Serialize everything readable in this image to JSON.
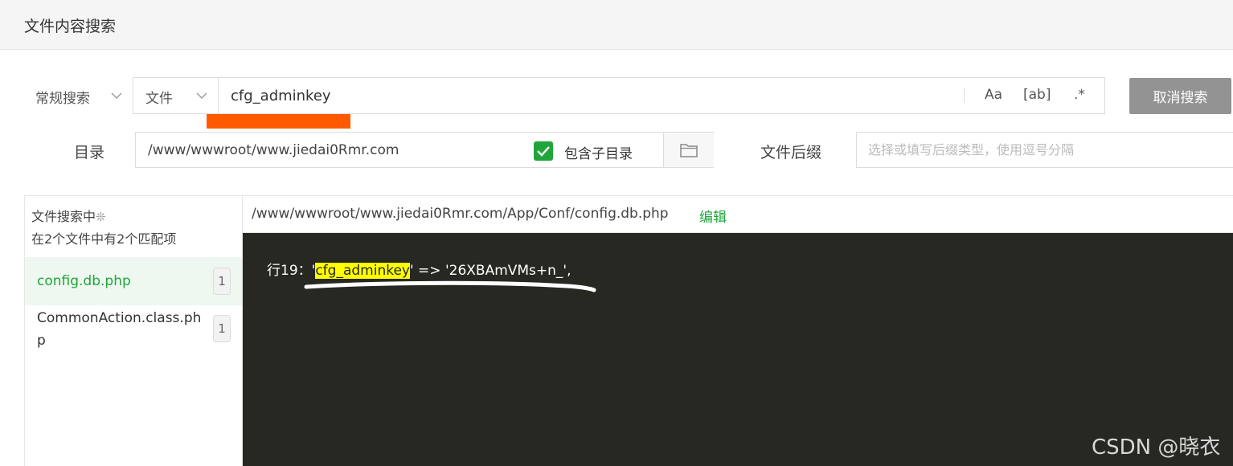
{
  "window": {
    "title": "文件内容搜索"
  },
  "search": {
    "mode_label": "常规搜索",
    "scope_label": "文件",
    "query": "cfg_adminkey",
    "options": {
      "case": "Aa",
      "word": "[ab]",
      "regex": ".*"
    },
    "cancel_label": "取消搜索"
  },
  "directory": {
    "label": "目录",
    "value": "/www/wwwroot/www.jiedai0Rmr.com",
    "include_subdir_label": "包含子目录",
    "include_subdir_checked": true
  },
  "suffix": {
    "label": "文件后缀",
    "placeholder": "选择或填写后缀类型，使用逗号分隔"
  },
  "results": {
    "status": "文件搜索中",
    "summary": "在2个文件中有2个匹配项",
    "files": [
      {
        "name": "config.db.php",
        "count": "1",
        "active": true
      },
      {
        "name": "CommonAction.class.php",
        "count": "1",
        "active": false
      }
    ],
    "current_path": "/www/wwwroot/www.jiedai0Rmr.com/App/Conf/config.db.php",
    "edit_label": "编辑",
    "line": {
      "prefix": "行19：",
      "before": "'",
      "match": "cfg_adminkey",
      "after": "' => '26XBAmVMs+n_',"
    }
  },
  "colors": {
    "accent": "#20a53a",
    "highlight": "#ffff00",
    "annotation": "#ff5a00",
    "code_bg": "#272822"
  },
  "icons": [
    "chevron-down-icon",
    "checkmark-icon",
    "folder-icon",
    "spinner-icon"
  ],
  "watermark": "CSDN @晓衣"
}
